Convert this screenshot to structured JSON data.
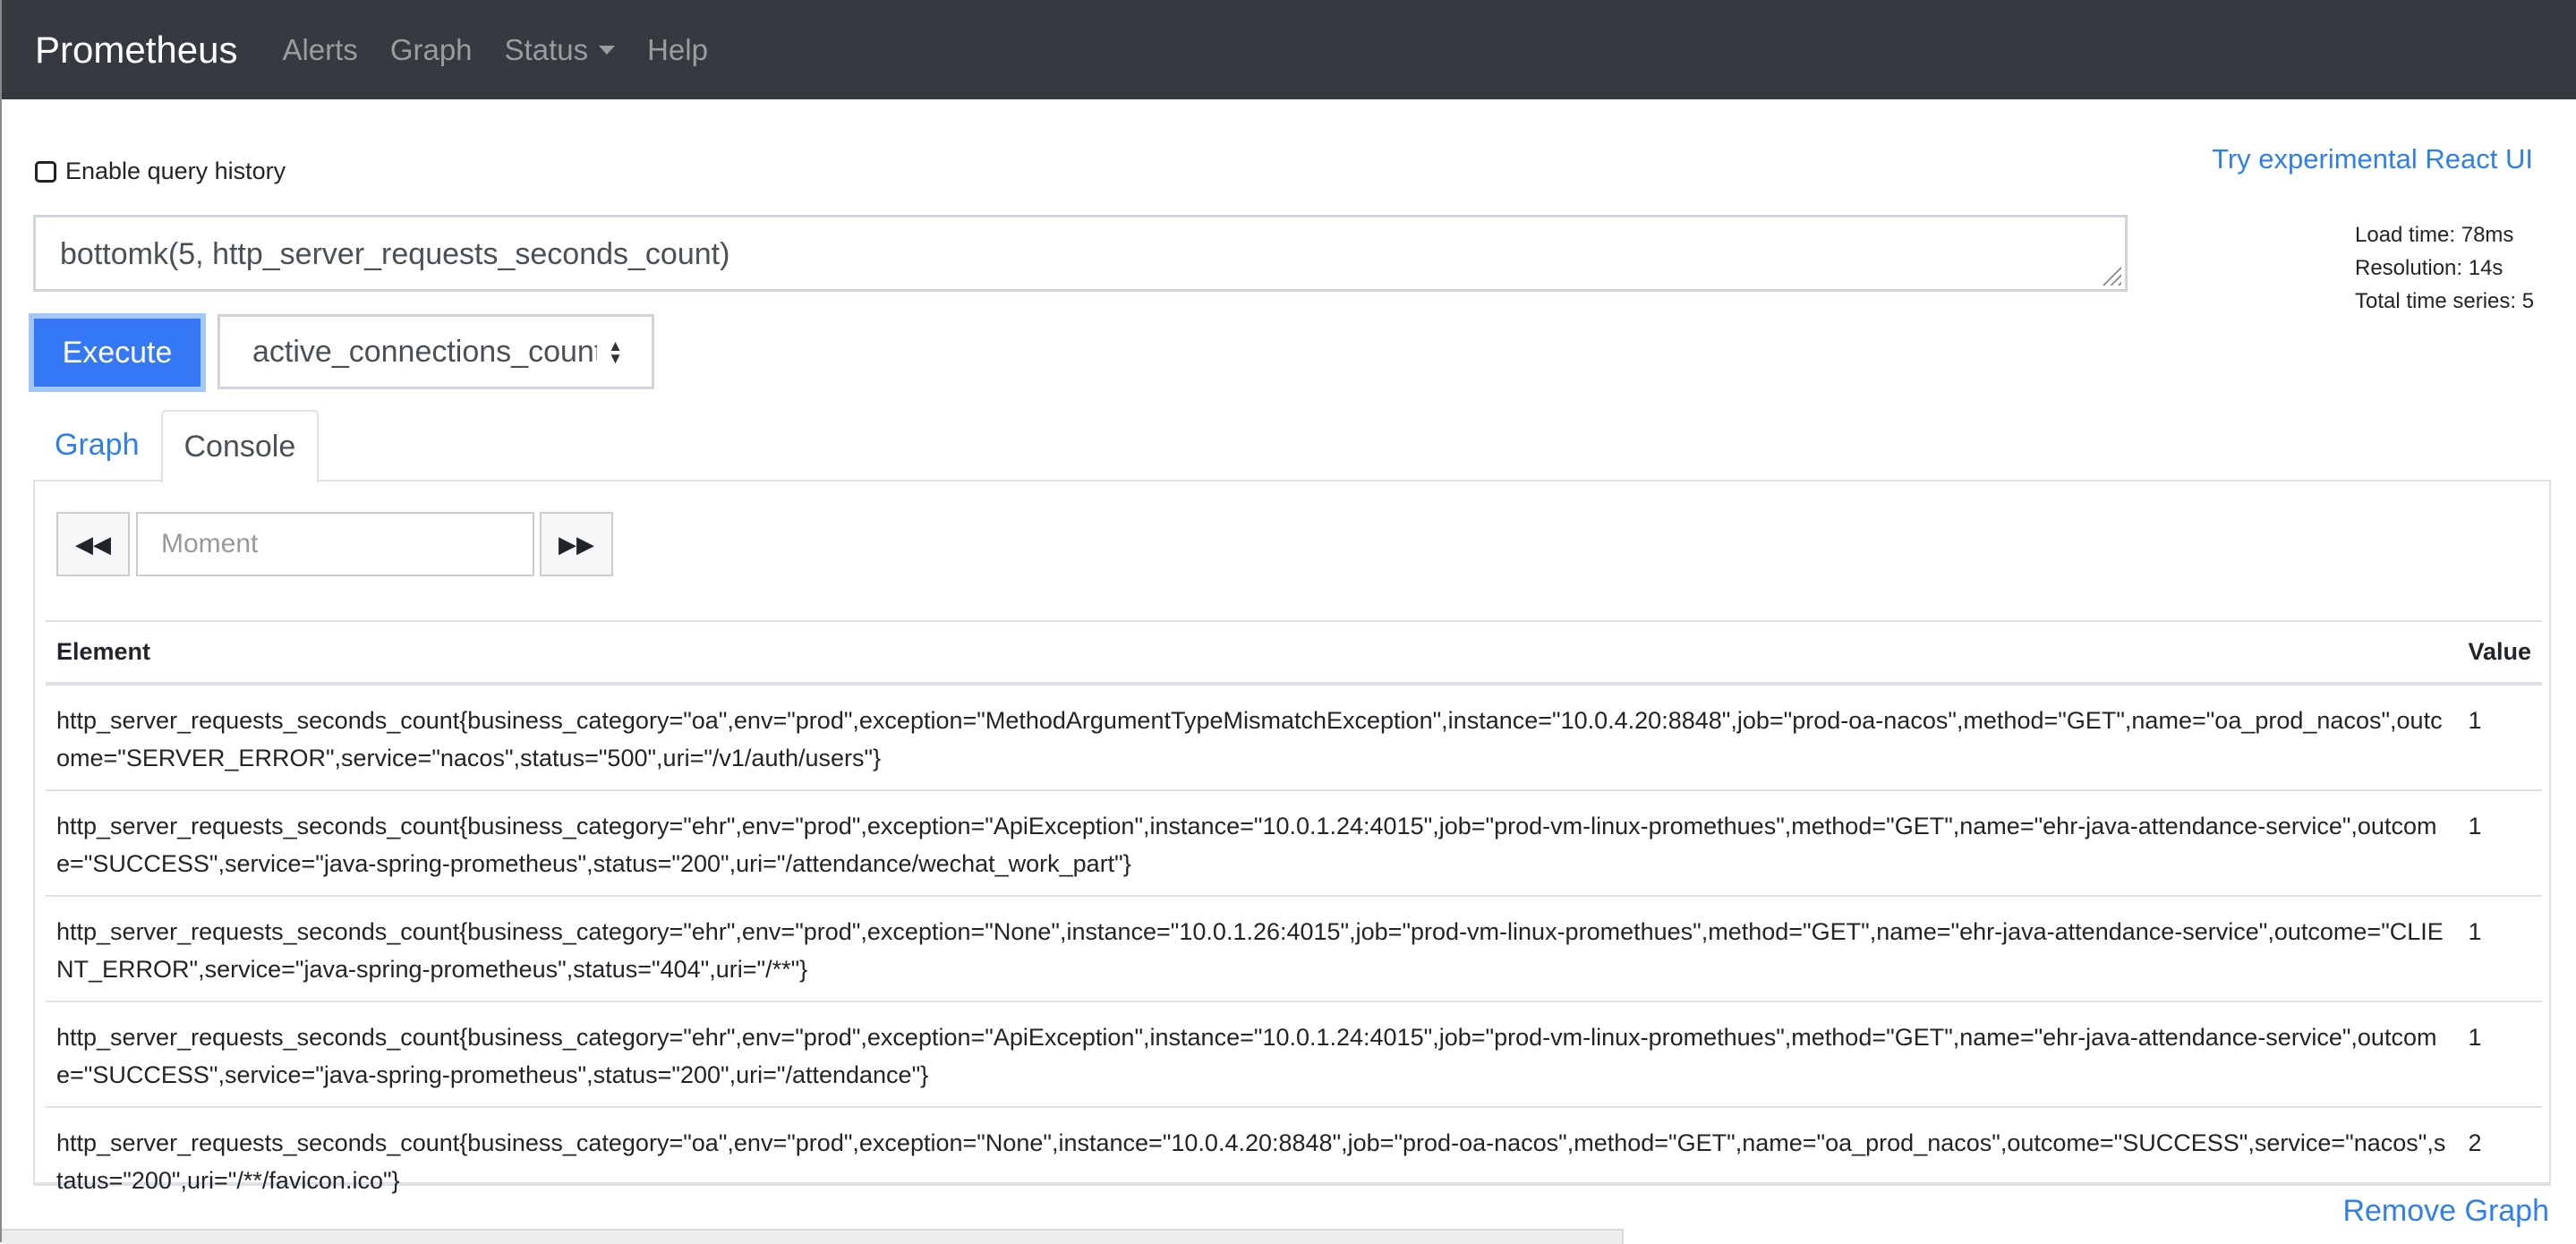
{
  "navbar": {
    "brand": "Prometheus",
    "items": [
      {
        "label": "Alerts"
      },
      {
        "label": "Graph"
      },
      {
        "label": "Status",
        "has_dropdown": true
      },
      {
        "label": "Help"
      }
    ]
  },
  "query_history": {
    "label": "Enable query history",
    "checked": false
  },
  "react_link": "Try experimental React UI",
  "query": {
    "expression": "bottomk(5, http_server_requests_seconds_count)"
  },
  "stats": {
    "load_time": "Load time: 78ms",
    "resolution": "Resolution: 14s",
    "total_series": "Total time series: 5"
  },
  "execute_label": "Execute",
  "metric_select": {
    "selected": "active_connections_count"
  },
  "tabs": [
    {
      "label": "Graph",
      "active": false
    },
    {
      "label": "Console",
      "active": true
    }
  ],
  "console": {
    "moment_placeholder": "Moment",
    "back_icon": "fast-backward-icon",
    "forward_icon": "fast-forward-icon",
    "columns": [
      "Element",
      "Value"
    ],
    "rows": [
      {
        "element": "http_server_requests_seconds_count{business_category=\"oa\",env=\"prod\",exception=\"MethodArgumentTypeMismatchException\",instance=\"10.0.4.20:8848\",job=\"prod-oa-nacos\",method=\"GET\",name=\"oa_prod_nacos\",outcome=\"SERVER_ERROR\",service=\"nacos\",status=\"500\",uri=\"/v1/auth/users\"}",
        "value": "1"
      },
      {
        "element": "http_server_requests_seconds_count{business_category=\"ehr\",env=\"prod\",exception=\"ApiException\",instance=\"10.0.1.24:4015\",job=\"prod-vm-linux-promethues\",method=\"GET\",name=\"ehr-java-attendance-service\",outcome=\"SUCCESS\",service=\"java-spring-prometheus\",status=\"200\",uri=\"/attendance/wechat_work_part\"}",
        "value": "1"
      },
      {
        "element": "http_server_requests_seconds_count{business_category=\"ehr\",env=\"prod\",exception=\"None\",instance=\"10.0.1.26:4015\",job=\"prod-vm-linux-promethues\",method=\"GET\",name=\"ehr-java-attendance-service\",outcome=\"CLIENT_ERROR\",service=\"java-spring-prometheus\",status=\"404\",uri=\"/**\"}",
        "value": "1"
      },
      {
        "element": "http_server_requests_seconds_count{business_category=\"ehr\",env=\"prod\",exception=\"ApiException\",instance=\"10.0.1.24:4015\",job=\"prod-vm-linux-promethues\",method=\"GET\",name=\"ehr-java-attendance-service\",outcome=\"SUCCESS\",service=\"java-spring-prometheus\",status=\"200\",uri=\"/attendance\"}",
        "value": "1"
      },
      {
        "element": "http_server_requests_seconds_count{business_category=\"oa\",env=\"prod\",exception=\"None\",instance=\"10.0.4.20:8848\",job=\"prod-oa-nacos\",method=\"GET\",name=\"oa_prod_nacos\",outcome=\"SUCCESS\",service=\"nacos\",status=\"200\",uri=\"/**/favicon.ico\"}",
        "value": "2"
      }
    ]
  },
  "remove_graph": "Remove Graph",
  "colors": {
    "navbar_bg": "#343a40",
    "link": "#2f80ed",
    "execute_bg": "#3478f6"
  }
}
